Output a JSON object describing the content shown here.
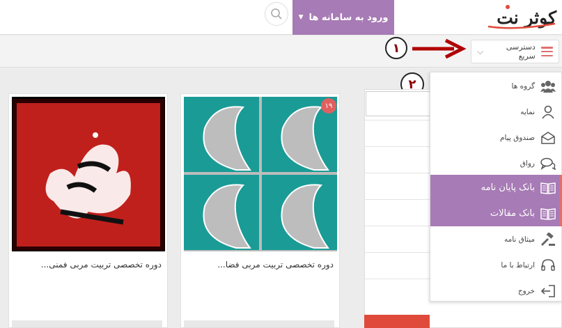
{
  "header": {
    "logo_text": "کوثر نت",
    "login_label": "ورود به سامانه ها",
    "login_caret": "▼"
  },
  "subbar": {
    "quick_access_label": "دسترسی سریع",
    "chevron": "⌵"
  },
  "annotations": {
    "step1": "۱",
    "step2": "۲"
  },
  "cards": [
    {
      "title": "دوره تخصصی تربیت مربی فضا...",
      "badge": "۱۹"
    },
    {
      "title": "دوره تخصصی تربیت مربی فمنی..."
    }
  ],
  "menu": {
    "items": [
      {
        "label": "گروه ها",
        "icon": "users-icon"
      },
      {
        "label": "نمایه",
        "icon": "user-icon"
      },
      {
        "label": "صندوق پیام",
        "icon": "envelope-icon"
      },
      {
        "label": "رواق",
        "icon": "chat-icon"
      },
      {
        "label": "بانک پایان نامه",
        "icon": "book-icon"
      },
      {
        "label": "بانک مقالات",
        "icon": "book-icon"
      },
      {
        "label": "میثاق نامه",
        "icon": "gavel-icon"
      },
      {
        "label": "ارتباط با ما",
        "icon": "headset-icon"
      },
      {
        "label": "خروج",
        "icon": "logout-icon"
      }
    ]
  },
  "colors": {
    "accent": "#a77bb5",
    "red": "#e04a3a",
    "teal": "#1a9b96"
  }
}
